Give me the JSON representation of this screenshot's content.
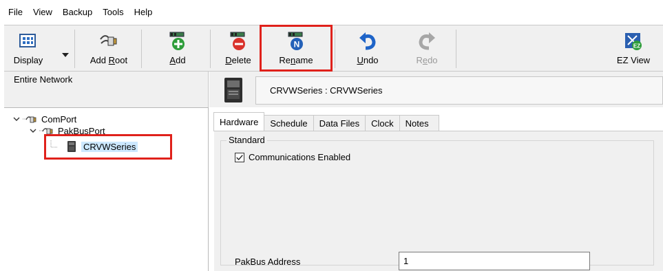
{
  "menubar": {
    "items": [
      "File",
      "View",
      "Backup",
      "Tools",
      "Help"
    ]
  },
  "toolbar": {
    "display": {
      "label": "Display",
      "icon": "display-grid-icon"
    },
    "add_root": {
      "label_pre": "Add ",
      "label_u": "R",
      "label_post": "oot",
      "icon": "network-root-icon"
    },
    "add": {
      "label_pre": "",
      "label_u": "A",
      "label_post": "dd",
      "icon": "add-device-icon"
    },
    "delete": {
      "label_pre": "",
      "label_u": "D",
      "label_post": "elete",
      "icon": "delete-device-icon"
    },
    "rename": {
      "label_pre": "Re",
      "label_u": "n",
      "label_post": "ame",
      "icon": "rename-device-icon"
    },
    "undo": {
      "label_pre": "",
      "label_u": "U",
      "label_post": "ndo",
      "icon": "undo-icon"
    },
    "redo": {
      "label_pre": "R",
      "label_u": "e",
      "label_post": "do",
      "icon": "redo-icon"
    },
    "ez_view": {
      "label": "EZ View",
      "icon": "ez-view-icon"
    }
  },
  "left_panel": {
    "header": "Entire Network",
    "tree": [
      {
        "label": "ComPort",
        "level": 0,
        "expanded": true
      },
      {
        "label": "PakBusPort",
        "level": 1,
        "expanded": true
      },
      {
        "label": "CRVWSeries",
        "level": 2,
        "selected": true
      }
    ]
  },
  "right_panel": {
    "device_title": "CRVWSeries : CRVWSeries",
    "tabs": [
      "Hardware",
      "Schedule",
      "Data Files",
      "Clock",
      "Notes"
    ],
    "active_tab": "Hardware",
    "hardware": {
      "group_title": "Standard",
      "communications_enabled_label": "Communications Enabled",
      "communications_enabled": true,
      "pakbus_address_label": "PakBus Address",
      "pakbus_address_value": "1"
    }
  },
  "colors": {
    "highlight": "#e0211b",
    "selection": "#cce8ff",
    "toolbar_bg": "#f0f0f0",
    "add_green": "#2e9d3a",
    "delete_red": "#d9322b",
    "rename_blue": "#2461b8"
  }
}
